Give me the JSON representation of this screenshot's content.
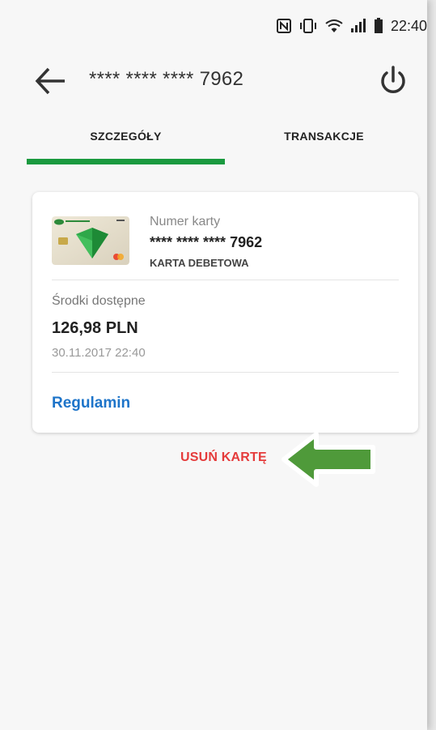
{
  "status_bar": {
    "time": "22:40",
    "icons": [
      "nfc-icon",
      "vibrate-icon",
      "wifi-icon",
      "signal-icon",
      "battery-icon"
    ]
  },
  "app_bar": {
    "back_icon": "arrow-left-icon",
    "title": "**** **** **** 7962",
    "power_icon": "power-icon"
  },
  "tabs": [
    {
      "label": "SZCZEGÓŁY",
      "active": true
    },
    {
      "label": "TRANSAKCJE",
      "active": false
    }
  ],
  "card_details": {
    "number_label": "Numer karty",
    "number_prefix": "**** **** ****",
    "number_last": "7962",
    "card_type": "KARTA DEBETOWA",
    "funds_label": "Środki dostępne",
    "funds_value": "126,98 PLN",
    "funds_date": "30.11.2017 22:40",
    "terms_link": "Regulamin"
  },
  "remove_card_label": "USUŃ KARTĘ",
  "colors": {
    "accent_green": "#1a9a3f",
    "link_blue": "#1d74c9",
    "danger_red": "#e53b3b",
    "annotation_arrow": "#4f9a3a"
  }
}
